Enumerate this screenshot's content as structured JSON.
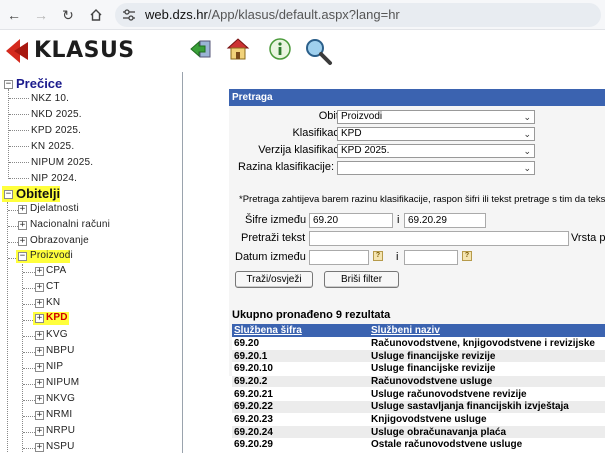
{
  "browser": {
    "url_host": "web.dzs.hr",
    "url_path": "/App/klasus/default.aspx?lang=hr"
  },
  "app": {
    "logo_text": "KLASUS"
  },
  "tree": {
    "precice": {
      "label": "Prečice",
      "items": [
        "NKZ 10.",
        "NKD 2025.",
        "KPD 2025.",
        "KN 2025.",
        "NIPUM 2025.",
        "NIP 2024."
      ]
    },
    "obitelji": {
      "label": "Obitelji",
      "groups": [
        "Djelatnosti",
        "Nacionalni računi",
        "Obrazovanje",
        "Proizvodi"
      ],
      "proizvodi_items": [
        "CPA",
        "CT",
        "KN",
        "KPD",
        "KVG",
        "NBPU",
        "NIP",
        "NIPUM",
        "NKVG",
        "NRMI",
        "NRPU",
        "NSPU"
      ],
      "selected": "KPD"
    }
  },
  "search": {
    "title": "Pretraga",
    "labels": {
      "obitelj": "Obitelj:",
      "klasifikacija": "Klasifikacija:",
      "verzija": "Verzija klasifikacije:",
      "razina": "Razina klasifikacije:",
      "sifre_izmedu": "Šifre između",
      "i1": "i",
      "pretrazi_tekst": "Pretraži tekst",
      "vrsta": "Vrsta p",
      "datum_izmedu": "Datum između",
      "i2": "i"
    },
    "values": {
      "obitelj": "Proizvodi",
      "klasifikacija": "KPD",
      "verzija": "KPD 2025.",
      "razina": "",
      "sifra_od": "69.20",
      "sifra_do": "69.20.29"
    },
    "note": "*Pretraga zahtijeva barem razinu klasifikacije, raspon šifri ili tekst pretrage s tim da tekst",
    "buttons": {
      "search": "Traži/osvježi",
      "clear": "Briši filter"
    }
  },
  "results": {
    "summary": "Ukupno pronađeno 9 rezultata",
    "headers": [
      "Službena šifra",
      "Službeni naziv"
    ],
    "rows": [
      [
        "69.20",
        "Računovodstvene, knjigovodstvene i revizijske"
      ],
      [
        "69.20.1",
        "Usluge financijske revizije"
      ],
      [
        "69.20.10",
        "Usluge financijske revizije"
      ],
      [
        "69.20.2",
        "Računovodstvene usluge"
      ],
      [
        "69.20.21",
        "Usluge računovodstvene revizije"
      ],
      [
        "69.20.22",
        "Usluge sastavljanja financijskih izvještaja"
      ],
      [
        "69.20.23",
        "Knjigovodstvene usluge"
      ],
      [
        "69.20.24",
        "Usluge obračunavanja plaća"
      ],
      [
        "69.20.29",
        "Ostale računovodstvene usluge"
      ]
    ]
  }
}
